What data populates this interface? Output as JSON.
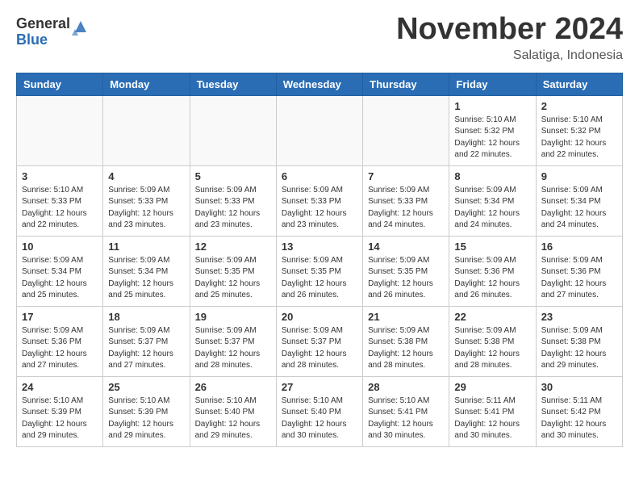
{
  "header": {
    "logo_general": "General",
    "logo_blue": "Blue",
    "month_title": "November 2024",
    "location": "Salatiga, Indonesia"
  },
  "weekdays": [
    "Sunday",
    "Monday",
    "Tuesday",
    "Wednesday",
    "Thursday",
    "Friday",
    "Saturday"
  ],
  "weeks": [
    [
      {
        "day": "",
        "info": ""
      },
      {
        "day": "",
        "info": ""
      },
      {
        "day": "",
        "info": ""
      },
      {
        "day": "",
        "info": ""
      },
      {
        "day": "",
        "info": ""
      },
      {
        "day": "1",
        "info": "Sunrise: 5:10 AM\nSunset: 5:32 PM\nDaylight: 12 hours\nand 22 minutes."
      },
      {
        "day": "2",
        "info": "Sunrise: 5:10 AM\nSunset: 5:32 PM\nDaylight: 12 hours\nand 22 minutes."
      }
    ],
    [
      {
        "day": "3",
        "info": "Sunrise: 5:10 AM\nSunset: 5:33 PM\nDaylight: 12 hours\nand 22 minutes."
      },
      {
        "day": "4",
        "info": "Sunrise: 5:09 AM\nSunset: 5:33 PM\nDaylight: 12 hours\nand 23 minutes."
      },
      {
        "day": "5",
        "info": "Sunrise: 5:09 AM\nSunset: 5:33 PM\nDaylight: 12 hours\nand 23 minutes."
      },
      {
        "day": "6",
        "info": "Sunrise: 5:09 AM\nSunset: 5:33 PM\nDaylight: 12 hours\nand 23 minutes."
      },
      {
        "day": "7",
        "info": "Sunrise: 5:09 AM\nSunset: 5:33 PM\nDaylight: 12 hours\nand 24 minutes."
      },
      {
        "day": "8",
        "info": "Sunrise: 5:09 AM\nSunset: 5:34 PM\nDaylight: 12 hours\nand 24 minutes."
      },
      {
        "day": "9",
        "info": "Sunrise: 5:09 AM\nSunset: 5:34 PM\nDaylight: 12 hours\nand 24 minutes."
      }
    ],
    [
      {
        "day": "10",
        "info": "Sunrise: 5:09 AM\nSunset: 5:34 PM\nDaylight: 12 hours\nand 25 minutes."
      },
      {
        "day": "11",
        "info": "Sunrise: 5:09 AM\nSunset: 5:34 PM\nDaylight: 12 hours\nand 25 minutes."
      },
      {
        "day": "12",
        "info": "Sunrise: 5:09 AM\nSunset: 5:35 PM\nDaylight: 12 hours\nand 25 minutes."
      },
      {
        "day": "13",
        "info": "Sunrise: 5:09 AM\nSunset: 5:35 PM\nDaylight: 12 hours\nand 26 minutes."
      },
      {
        "day": "14",
        "info": "Sunrise: 5:09 AM\nSunset: 5:35 PM\nDaylight: 12 hours\nand 26 minutes."
      },
      {
        "day": "15",
        "info": "Sunrise: 5:09 AM\nSunset: 5:36 PM\nDaylight: 12 hours\nand 26 minutes."
      },
      {
        "day": "16",
        "info": "Sunrise: 5:09 AM\nSunset: 5:36 PM\nDaylight: 12 hours\nand 27 minutes."
      }
    ],
    [
      {
        "day": "17",
        "info": "Sunrise: 5:09 AM\nSunset: 5:36 PM\nDaylight: 12 hours\nand 27 minutes."
      },
      {
        "day": "18",
        "info": "Sunrise: 5:09 AM\nSunset: 5:37 PM\nDaylight: 12 hours\nand 27 minutes."
      },
      {
        "day": "19",
        "info": "Sunrise: 5:09 AM\nSunset: 5:37 PM\nDaylight: 12 hours\nand 28 minutes."
      },
      {
        "day": "20",
        "info": "Sunrise: 5:09 AM\nSunset: 5:37 PM\nDaylight: 12 hours\nand 28 minutes."
      },
      {
        "day": "21",
        "info": "Sunrise: 5:09 AM\nSunset: 5:38 PM\nDaylight: 12 hours\nand 28 minutes."
      },
      {
        "day": "22",
        "info": "Sunrise: 5:09 AM\nSunset: 5:38 PM\nDaylight: 12 hours\nand 28 minutes."
      },
      {
        "day": "23",
        "info": "Sunrise: 5:09 AM\nSunset: 5:38 PM\nDaylight: 12 hours\nand 29 minutes."
      }
    ],
    [
      {
        "day": "24",
        "info": "Sunrise: 5:10 AM\nSunset: 5:39 PM\nDaylight: 12 hours\nand 29 minutes."
      },
      {
        "day": "25",
        "info": "Sunrise: 5:10 AM\nSunset: 5:39 PM\nDaylight: 12 hours\nand 29 minutes."
      },
      {
        "day": "26",
        "info": "Sunrise: 5:10 AM\nSunset: 5:40 PM\nDaylight: 12 hours\nand 29 minutes."
      },
      {
        "day": "27",
        "info": "Sunrise: 5:10 AM\nSunset: 5:40 PM\nDaylight: 12 hours\nand 30 minutes."
      },
      {
        "day": "28",
        "info": "Sunrise: 5:10 AM\nSunset: 5:41 PM\nDaylight: 12 hours\nand 30 minutes."
      },
      {
        "day": "29",
        "info": "Sunrise: 5:11 AM\nSunset: 5:41 PM\nDaylight: 12 hours\nand 30 minutes."
      },
      {
        "day": "30",
        "info": "Sunrise: 5:11 AM\nSunset: 5:42 PM\nDaylight: 12 hours\nand 30 minutes."
      }
    ]
  ]
}
